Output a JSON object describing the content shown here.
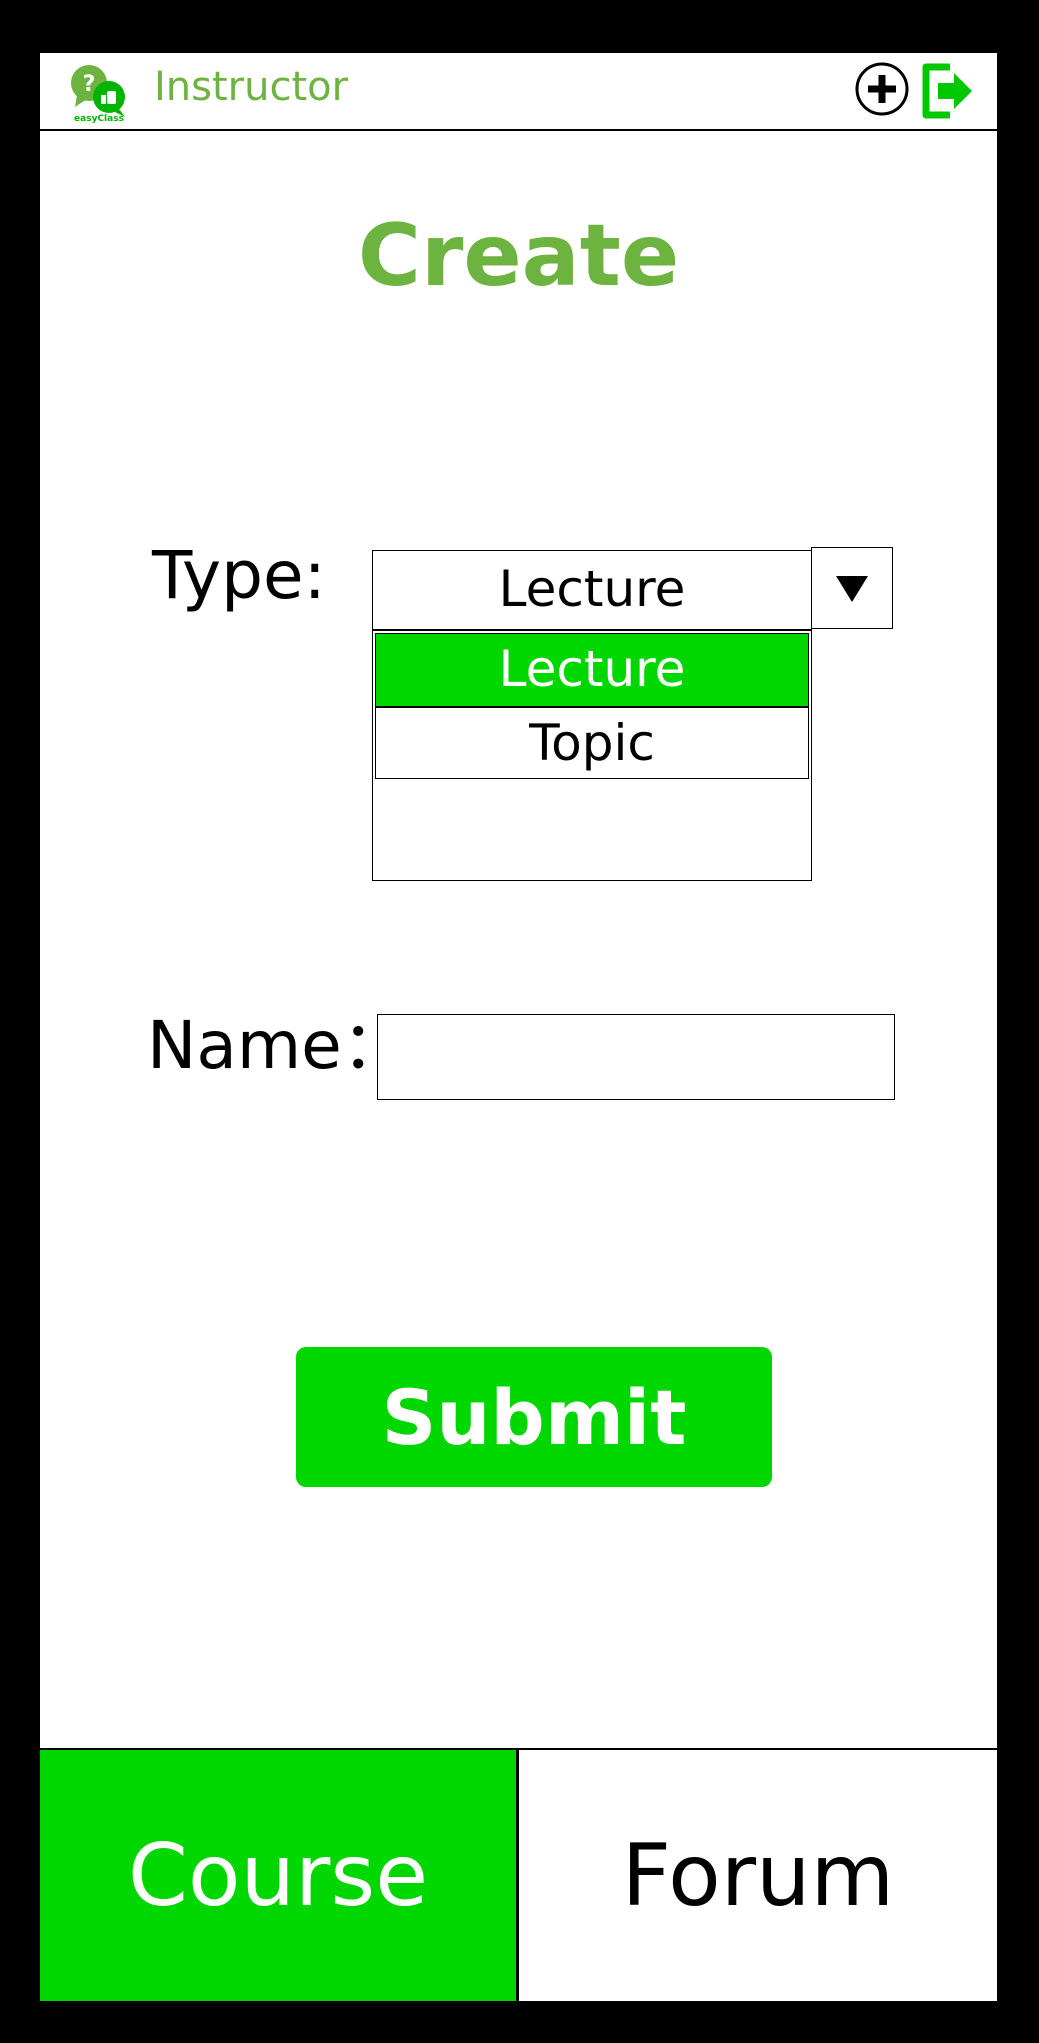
{
  "header": {
    "role_title": "Instructor",
    "logo_text": "easyClass",
    "logo_icon": "chat-bubbles-logo",
    "add_icon": "plus-circle-icon",
    "logout_icon": "logout-icon"
  },
  "page": {
    "title": "Create"
  },
  "form": {
    "type_label": "Type:",
    "type_selected": "Lecture",
    "type_options": [
      "Lecture",
      "Topic"
    ],
    "dropdown_icon": "triangle-down-icon",
    "name_label": "Name：",
    "name_value": "",
    "submit_label": "Submit"
  },
  "nav": {
    "items": [
      {
        "label": "Course",
        "active": true
      },
      {
        "label": "Forum",
        "active": false
      }
    ]
  },
  "colors": {
    "brand_green": "#6db33f",
    "accent_green": "#00d600",
    "background": "#ffffff",
    "frame": "#000000"
  }
}
